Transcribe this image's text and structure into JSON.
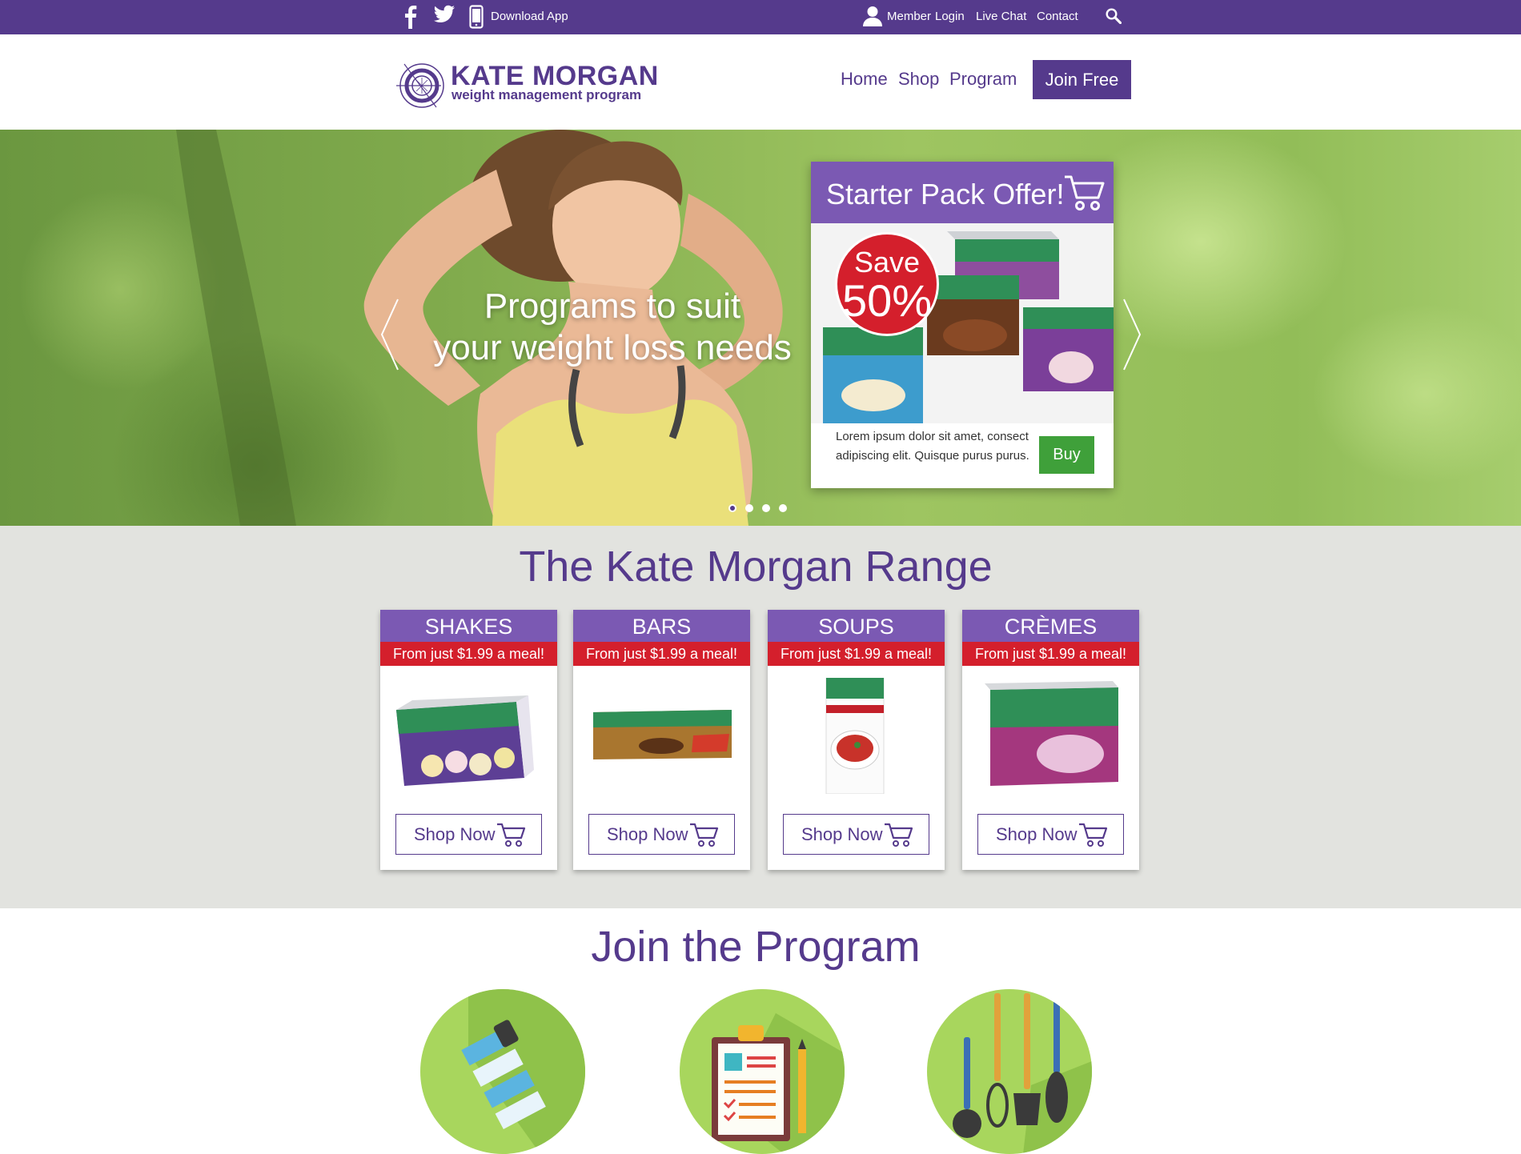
{
  "topbar": {
    "download_app": "Download App",
    "member": "Member",
    "login": "Login",
    "live_chat": "Live Chat",
    "contact": "Contact",
    "icons": [
      "facebook-icon",
      "twitter-icon",
      "mobile-phone-icon",
      "user-icon",
      "search-icon"
    ]
  },
  "header": {
    "brand": "KATE MORGAN",
    "tagline": "weight management program",
    "nav": [
      "Home",
      "Shop",
      "Program"
    ],
    "join_label": "Join Free"
  },
  "hero": {
    "line1": "Programs to suit",
    "line2": "your weight loss needs",
    "slide_count": 4,
    "active_slide": 1,
    "offer": {
      "title": "Starter Pack Offer!",
      "save_word": "Save",
      "save_pct": "50%",
      "text": "Lorem ipsum dolor sit amet, consect adipiscing elit. Quisque purus purus.",
      "buy_label": "Buy"
    }
  },
  "range": {
    "title": "The Kate Morgan Range",
    "shop_label": "Shop Now",
    "cards": [
      {
        "title": "SHAKES",
        "price": "From just $1.99 a meal!"
      },
      {
        "title": "BARS",
        "price": "From just $1.99 a meal!"
      },
      {
        "title": "SOUPS",
        "price": "From just $1.99 a meal!"
      },
      {
        "title": "CRÈMES",
        "price": "From just $1.99 a meal!"
      }
    ]
  },
  "join": {
    "title": "Join the Program",
    "icons": [
      "measuring-tape-icon",
      "clipboard-checklist-icon",
      "kitchen-utensils-icon"
    ]
  },
  "colors": {
    "brand_purple": "#553a8c",
    "card_purple": "#7b59b3",
    "price_red": "#d41f2c",
    "buy_green": "#3fa03a",
    "circle_green": "#a8d65d"
  }
}
